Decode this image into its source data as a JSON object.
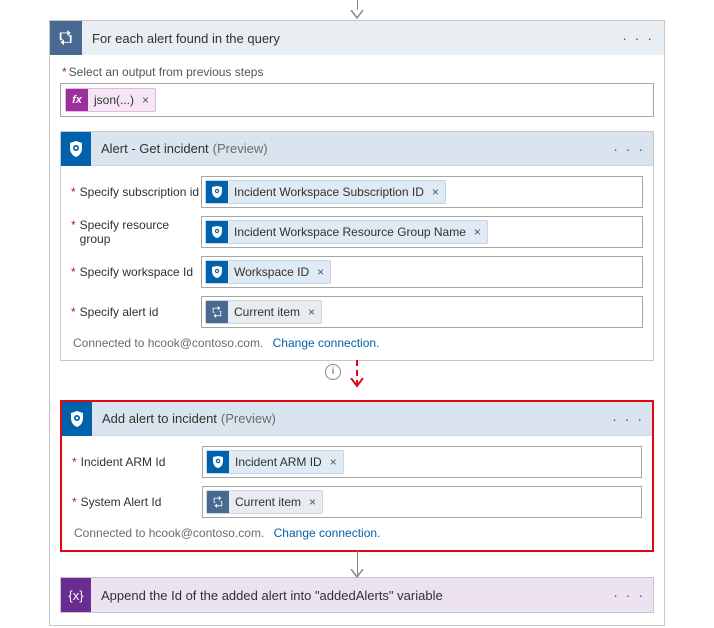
{
  "foreach": {
    "title": "For each alert found in the query",
    "prev_step_label": "Select an output from previous steps",
    "prev_step_token": "json(...)"
  },
  "get_incident": {
    "title": "Alert - Get incident",
    "preview": "(Preview)",
    "fields": {
      "subscription": {
        "label": "Specify subscription id",
        "token": "Incident Workspace Subscription ID"
      },
      "rg": {
        "label": "Specify resource group",
        "token": "Incident Workspace Resource Group Name"
      },
      "workspace": {
        "label": "Specify workspace Id",
        "token": "Workspace ID"
      },
      "alert": {
        "label": "Specify alert id",
        "token": "Current item"
      }
    },
    "connected": "Connected to hcook@contoso.com.",
    "change": "Change connection."
  },
  "add_alert": {
    "title": "Add alert to incident",
    "preview": "(Preview)",
    "fields": {
      "arm": {
        "label": "Incident ARM Id",
        "token": "Incident ARM ID"
      },
      "sysid": {
        "label": "System Alert Id",
        "token": "Current item"
      }
    },
    "connected": "Connected to hcook@contoso.com.",
    "change": "Change connection."
  },
  "append": {
    "title": "Append the Id of the added alert into \"addedAlerts\" variable"
  },
  "misc": {
    "remove_x": "×",
    "info_i": "i",
    "dots": "· · ·"
  }
}
